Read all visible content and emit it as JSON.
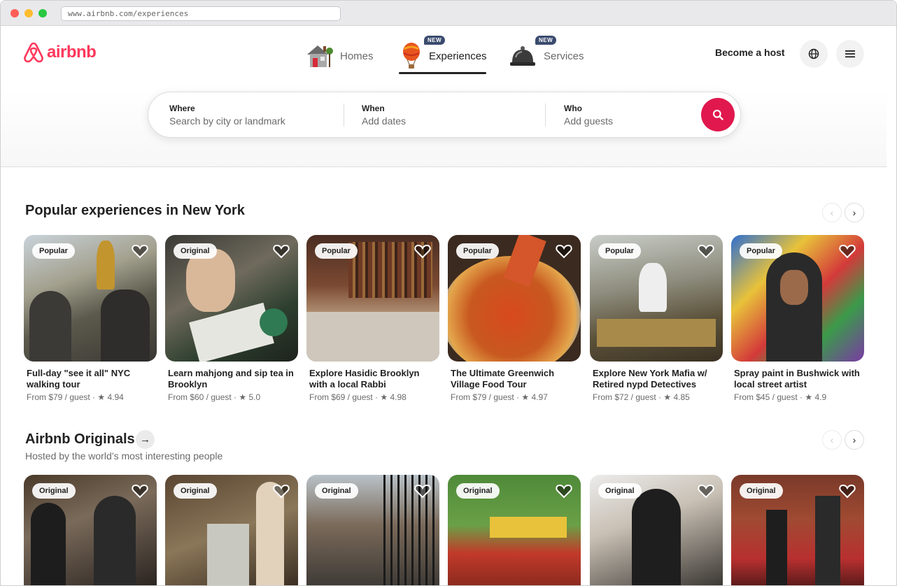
{
  "browser": {
    "url": "www.airbnb.com/experiences"
  },
  "brand": {
    "name": "airbnb",
    "color": "#ff385c"
  },
  "nav": {
    "homes": {
      "label": "Homes",
      "icon": "house-icon"
    },
    "experiences": {
      "label": "Experiences",
      "badge": "NEW",
      "icon": "hot-air-balloon-icon"
    },
    "services": {
      "label": "Services",
      "badge": "NEW",
      "icon": "service-bell-icon"
    }
  },
  "header": {
    "become_host": "Become a host"
  },
  "search": {
    "where": {
      "title": "Where",
      "placeholder": "Search by city or landmark"
    },
    "when": {
      "title": "When",
      "placeholder": "Add dates"
    },
    "who": {
      "title": "Who",
      "placeholder": "Add guests"
    }
  },
  "popular": {
    "title": "Popular experiences in New York",
    "cards": [
      {
        "tag": "Popular",
        "title": "Full-day \"see it all\" NYC walking tour",
        "meta": "From $79 / guest · ★ 4.94"
      },
      {
        "tag": "Original",
        "title": "Learn mahjong and sip tea in Brooklyn",
        "meta": "From $60 / guest · ★ 5.0"
      },
      {
        "tag": "Popular",
        "title": "Explore Hasidic Brooklyn with a local Rabbi",
        "meta": "From $69 / guest · ★ 4.98"
      },
      {
        "tag": "Popular",
        "title": "The Ultimate Greenwich Village Food Tour",
        "meta": "From $79 / guest · ★ 4.97"
      },
      {
        "tag": "Popular",
        "title": "Explore New York Mafia w/ Retired nypd Detectives",
        "meta": "From $72 / guest · ★ 4.85"
      },
      {
        "tag": "Popular",
        "title": "Spray paint in Bushwick with local street artist",
        "meta": "From $45 / guest · ★ 4.9"
      }
    ]
  },
  "originals": {
    "title": "Airbnb Originals",
    "subtitle": "Hosted by the world’s most interesting people",
    "cards": [
      {
        "tag": "Original"
      },
      {
        "tag": "Original"
      },
      {
        "tag": "Original"
      },
      {
        "tag": "Original"
      },
      {
        "tag": "Original"
      },
      {
        "tag": "Original"
      }
    ]
  }
}
